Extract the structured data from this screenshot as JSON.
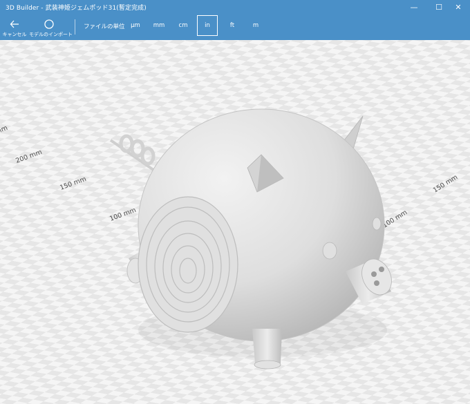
{
  "window": {
    "title": "3D Builder - 武装神姫ジェムポッド31(暫定完成)",
    "controls": {
      "minimize": "—",
      "maximize": "☐",
      "close": "✕"
    }
  },
  "toolbar": {
    "cancel_label": "キャンセル",
    "import_label": "モデルのインポート",
    "units_label": "ファイルの単位",
    "units": [
      "µm",
      "mm",
      "cm",
      "in",
      "ft",
      "m"
    ],
    "selected_unit": "in"
  },
  "viewport": {
    "ruler_labels": {
      "left_200": "200 mm",
      "left_150": "150 mm",
      "left_100": "100 mm",
      "right_100": "100 mm",
      "right_150": "150 mm",
      "left_edge": "mm"
    },
    "colors": {
      "floor_light": "#f5f5f5",
      "floor_dark": "#e6e6e6",
      "model": "#d9d9d9"
    }
  }
}
